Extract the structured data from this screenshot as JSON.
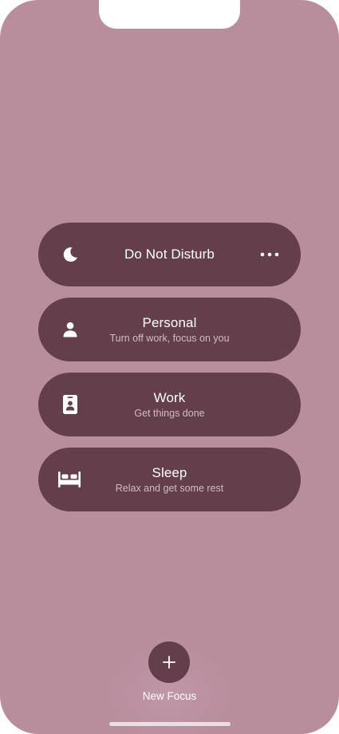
{
  "colors": {
    "background": "#b98e9c",
    "pill": "#633f4b",
    "text": "#ffffff",
    "subtext": "#d4b9c2"
  },
  "focus_modes": [
    {
      "icon": "moon-icon",
      "title": "Do Not Disturb",
      "subtitle": "",
      "has_more_menu": true
    },
    {
      "icon": "person-icon",
      "title": "Personal",
      "subtitle": "Turn off work, focus on you"
    },
    {
      "icon": "id-badge-icon",
      "title": "Work",
      "subtitle": "Get things done"
    },
    {
      "icon": "bed-icon",
      "title": "Sleep",
      "subtitle": "Relax and get some rest"
    }
  ],
  "new_focus": {
    "icon": "plus-icon",
    "label": "New Focus"
  }
}
